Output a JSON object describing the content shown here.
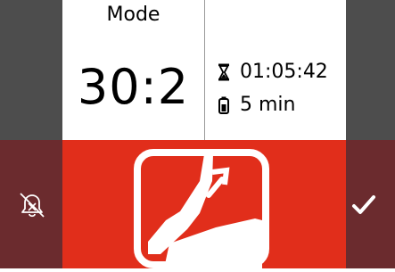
{
  "mode": {
    "label": "Mode",
    "value": "30:2"
  },
  "info": {
    "timer_value": "01:05:42",
    "timer_icon": "hourglass-icon",
    "duration_value": "5 min",
    "duration_icon": "battery-icon"
  },
  "actions": {
    "left_icon": "alarm-muted-icon",
    "right_icon": "checkmark-icon",
    "center_icon": "cpr-compression-icon"
  },
  "colors": {
    "side_dark": "#4d4d4d",
    "side_red": "#6b2b2e",
    "alert_red": "#e12e1b",
    "panel": "#ffffff"
  }
}
